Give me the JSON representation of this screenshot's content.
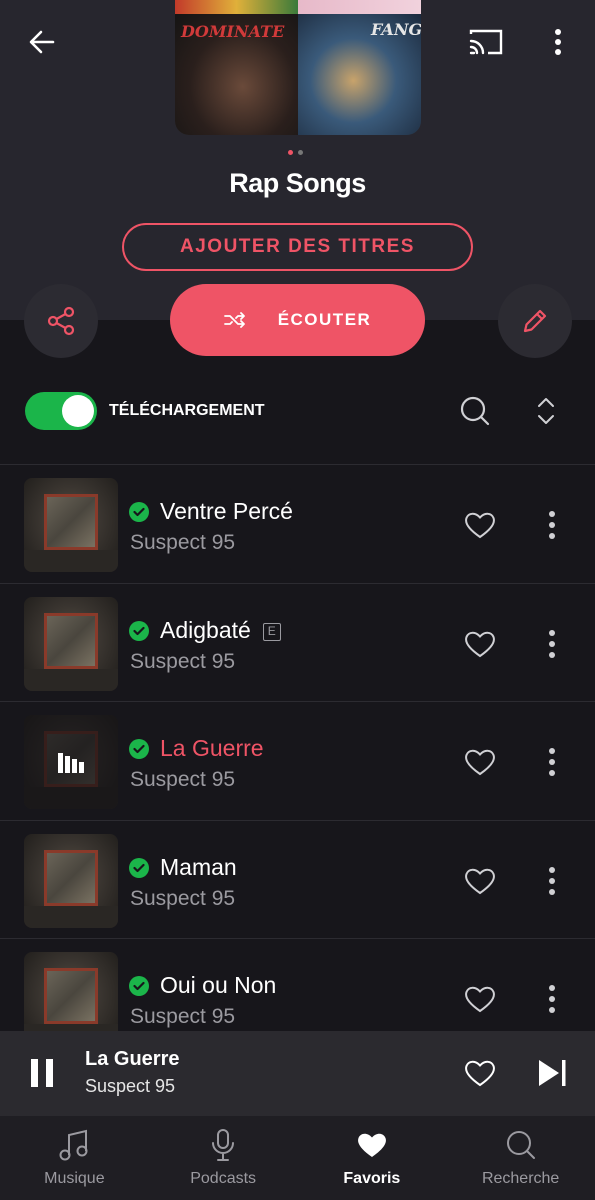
{
  "playlist": {
    "title": "Rap Songs",
    "cover_captions": [
      "DOMINATE",
      "FANGE"
    ],
    "carousel": {
      "count": 2,
      "active_index": 0
    }
  },
  "actions": {
    "add_tracks_label": "AJOUTER DES TITRES",
    "play_label": "ÉCOUTER"
  },
  "download": {
    "label": "TÉLÉCHARGEMENT",
    "enabled": true
  },
  "tracks": [
    {
      "title": "Ventre Percé",
      "artist": "Suspect 95",
      "downloaded": true,
      "explicit": false,
      "playing": false
    },
    {
      "title": "Adigbaté",
      "artist": "Suspect 95",
      "downloaded": true,
      "explicit": true,
      "explicit_badge": "E",
      "playing": false
    },
    {
      "title": "La Guerre",
      "artist": "Suspect 95",
      "downloaded": true,
      "explicit": false,
      "playing": true
    },
    {
      "title": "Maman",
      "artist": "Suspect 95",
      "downloaded": true,
      "explicit": false,
      "playing": false
    },
    {
      "title": "Oui ou Non",
      "artist": "Suspect 95",
      "downloaded": true,
      "explicit": false,
      "playing": false
    }
  ],
  "mini_player": {
    "title": "La Guerre",
    "artist": "Suspect 95"
  },
  "bottom_nav": [
    {
      "label": "Musique",
      "icon": "music-note-icon",
      "active": false
    },
    {
      "label": "Podcasts",
      "icon": "microphone-icon",
      "active": false
    },
    {
      "label": "Favoris",
      "icon": "heart-icon",
      "active": true
    },
    {
      "label": "Recherche",
      "icon": "search-icon",
      "active": false
    }
  ],
  "colors": {
    "accent": "#ef5466",
    "success": "#1bb54a",
    "background": "#17161b",
    "header_bg": "#27262e"
  }
}
